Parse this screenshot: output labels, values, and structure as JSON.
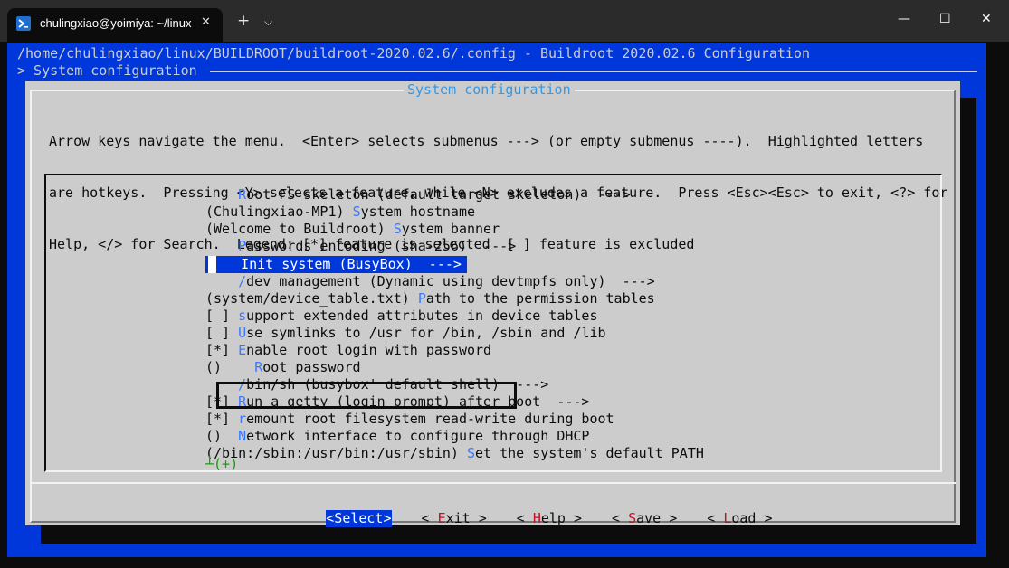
{
  "window": {
    "tab_title": "chulingxiao@yoimiya: ~/linux",
    "tab_close_icon": "close-icon",
    "new_tab": "+",
    "dropdown": "⌵",
    "minimize": "—",
    "maximize": "☐",
    "close": "✕"
  },
  "terminal": {
    "path_line": "/home/chulingxiao/linux/BUILDROOT/buildroot-2020.02.6/.config - Buildroot 2020.02.6 Configuration",
    "breadcrumb": "> System configuration"
  },
  "dialog": {
    "title": "System configuration",
    "help_lines": [
      "Arrow keys navigate the menu.  <Enter> selects submenus ---> (or empty submenus ----).  Highlighted letters",
      "are hotkeys.  Pressing <Y> selects a feature, while <N> excludes a feature.  Press <Esc><Esc> to exit, <?> for",
      "Help, </> for Search.  Legend: [*] feature is selected  [ ] feature is excluded"
    ]
  },
  "menu": {
    "items": [
      {
        "pre": "    ",
        "hotkey": "R",
        "rest": "oot FS skeleton (default target skeleton)  --->"
      },
      {
        "pre": "(Chulingxiao-MP1) ",
        "hotkey": "S",
        "rest": "ystem hostname"
      },
      {
        "pre": "(Welcome to Buildroot) ",
        "hotkey": "S",
        "rest": "ystem banner"
      },
      {
        "pre": "    ",
        "hotkey": "P",
        "rest": "asswords encoding (sha-256)  --->"
      },
      {
        "pre": "    ",
        "hotkey": "I",
        "rest": "nit system (BusyBox)  --->"
      },
      {
        "pre": "    ",
        "hotkey": "/",
        "rest": "dev management (Dynamic using devtmpfs only)  --->"
      },
      {
        "pre": "(system/device_table.txt) ",
        "hotkey": "P",
        "rest": "ath to the permission tables"
      },
      {
        "pre": "[ ] ",
        "hotkey": "s",
        "rest": "upport extended attributes in device tables"
      },
      {
        "pre": "[ ] ",
        "hotkey": "U",
        "rest": "se symlinks to /usr for /bin, /sbin and /lib"
      },
      {
        "pre": "[*] ",
        "hotkey": "E",
        "rest": "nable root login with password"
      },
      {
        "pre": "()    ",
        "hotkey": "R",
        "rest": "oot password"
      },
      {
        "pre": "    ",
        "hotkey": "/",
        "rest": "bin/sh (busybox' default shell)  --->"
      },
      {
        "pre": "[*] ",
        "hotkey": "R",
        "rest": "un a getty (login prompt) after boot  --->"
      },
      {
        "pre": "[*] ",
        "hotkey": "r",
        "rest": "emount root filesystem read-write during boot"
      },
      {
        "pre": "()  ",
        "hotkey": "N",
        "rest": "etwork interface to configure through DHCP"
      },
      {
        "pre": "(/bin:/sbin:/usr/bin:/usr/sbin) ",
        "hotkey": "S",
        "rest": "et the system's default PATH"
      }
    ],
    "selected_index": 4,
    "more_indicator": "┴(+)"
  },
  "buttons": {
    "select": {
      "pre": "<",
      "hotkey": "S",
      "rest": "elect>"
    },
    "exit": {
      "pre": "< ",
      "hotkey": "E",
      "rest": "xit >"
    },
    "help": {
      "pre": "< ",
      "hotkey": "H",
      "rest": "elp >"
    },
    "save": {
      "pre": "< ",
      "hotkey": "S",
      "rest": "ave >"
    },
    "load": {
      "pre": "< ",
      "hotkey": "L",
      "rest": "oad >"
    }
  },
  "colors": {
    "terminal_bg": "#0c0c0c",
    "menuconfig_blue": "#0037da",
    "dialog_gray": "#cccccc",
    "hotkey_blue": "#3b78ff",
    "button_hotkey_red": "#c50f1f",
    "title_cyan": "#3a96dd",
    "more_green": "#13a10e"
  }
}
